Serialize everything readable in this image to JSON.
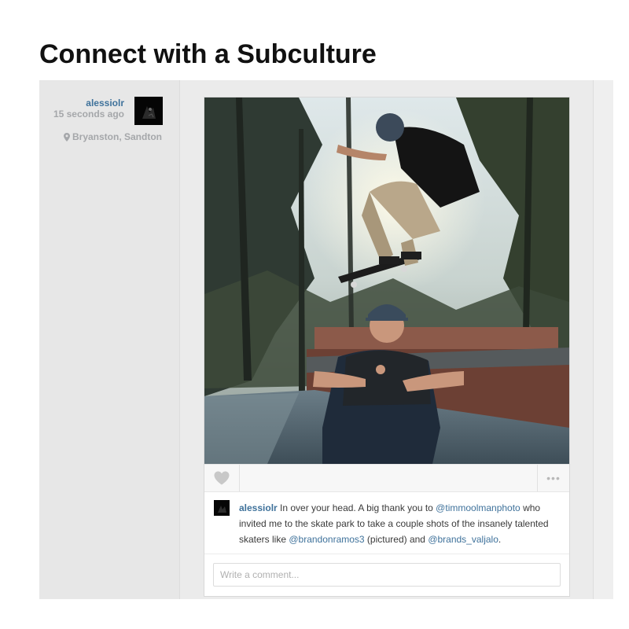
{
  "page": {
    "title": "Connect with a Subculture"
  },
  "post": {
    "author": "alessiolr",
    "time": "15 seconds ago",
    "location": "Bryanston, Sandton",
    "more_label": "•••",
    "caption": {
      "username": "alessiolr",
      "segments": [
        {
          "type": "text",
          "value": " In over your head. A big thank you to "
        },
        {
          "type": "mention",
          "value": "@timmoolmanphoto"
        },
        {
          "type": "text",
          "value": " who invited me to the skate park to take a couple shots of the insanely talented skaters like "
        },
        {
          "type": "mention",
          "value": "@brandonramos3"
        },
        {
          "type": "text",
          "value": " (pictured) and "
        },
        {
          "type": "mention",
          "value": "@brands_valjalo"
        },
        {
          "type": "text",
          "value": "."
        }
      ]
    },
    "comment_placeholder": "Write a comment..."
  },
  "icons": {
    "location": "map-pin-icon",
    "like": "heart-icon",
    "more": "ellipsis-icon"
  },
  "colors": {
    "link": "#3f729b",
    "muted": "#a5a7aa",
    "heart": "#c8c8c8"
  }
}
